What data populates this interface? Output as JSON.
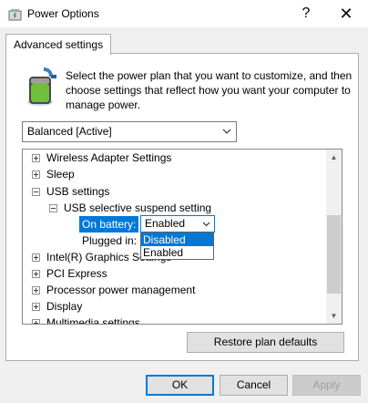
{
  "window": {
    "title": "Power Options",
    "help_glyph": "?",
    "close_glyph": "✕"
  },
  "tabs": [
    {
      "label": "Advanced settings"
    }
  ],
  "header": {
    "instructions": "Select the power plan that you want to customize, and then choose settings that reflect how you want your computer to manage power."
  },
  "plan": {
    "selected": "Balanced [Active]"
  },
  "tree": {
    "items": [
      {
        "label": "Wireless Adapter Settings",
        "expanded": false
      },
      {
        "label": "Sleep",
        "expanded": false
      },
      {
        "label": "USB settings",
        "expanded": true
      },
      {
        "label": "USB selective suspend setting",
        "expanded": true
      },
      {
        "label": "On battery:"
      },
      {
        "label": "Plugged in:"
      },
      {
        "label": "Intel(R) Graphics Settings",
        "expanded": false
      },
      {
        "label": "PCI Express",
        "expanded": false
      },
      {
        "label": "Processor power management",
        "expanded": false
      },
      {
        "label": "Display",
        "expanded": false
      },
      {
        "label": "Multimedia settings",
        "expanded": false
      }
    ],
    "on_battery_value": "Enabled",
    "dropdown_options": [
      "Disabled",
      "Enabled"
    ],
    "dropdown_highlighted": "Disabled"
  },
  "buttons": {
    "restore": "Restore plan defaults",
    "ok": "OK",
    "cancel": "Cancel",
    "apply": "Apply"
  },
  "colors": {
    "accent": "#0078d7",
    "window_bg": "#f0f0f0"
  }
}
